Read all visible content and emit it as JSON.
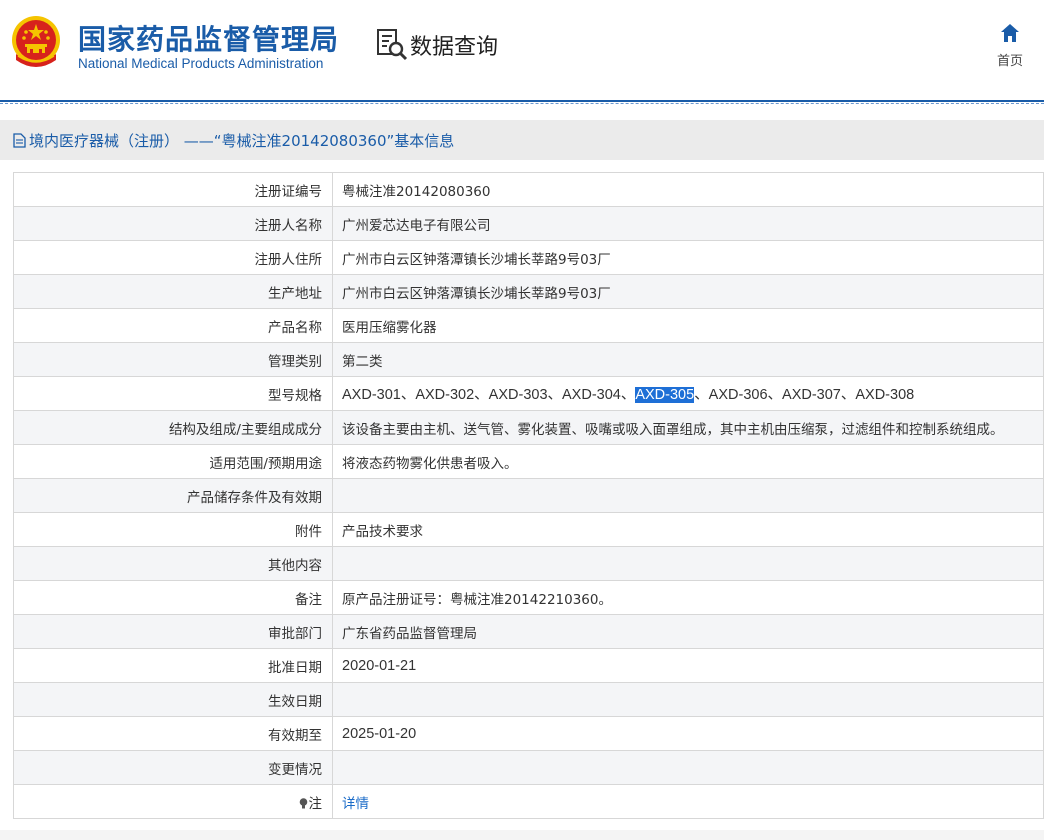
{
  "header": {
    "org_name_cn": "国家药品监督管理局",
    "org_name_en": "National Medical Products Administration",
    "query_label": "数据查询",
    "home_label": "首页"
  },
  "breadcrumb": {
    "text": "境内医疗器械（注册）  ——“粤械注准20142080360”基本信息"
  },
  "rows": [
    {
      "label": "注册证编号",
      "value": "粤械注准20142080360"
    },
    {
      "label": "注册人名称",
      "value": "广州爱芯达电子有限公司"
    },
    {
      "label": "注册人住所",
      "value": "广州市白云区钟落潭镇长沙埔长莘路9号03厂"
    },
    {
      "label": "生产地址",
      "value": "广州市白云区钟落潭镇长沙埔长莘路9号03厂"
    },
    {
      "label": "产品名称",
      "value": "医用压缩雾化器"
    },
    {
      "label": "管理类别",
      "value": "第二类"
    },
    {
      "label": "型号规格",
      "value_before": "AXD-301、AXD-302、AXD-303、AXD-304、",
      "value_selected": "AXD-305",
      "value_after": "、AXD-306、AXD-307、AXD-308"
    },
    {
      "label": "结构及组成/主要组成成分",
      "value": "该设备主要由主机、送气管、雾化装置、吸嘴或吸入面罩组成，其中主机由压缩泵，过滤组件和控制系统组成。"
    },
    {
      "label": "适用范围/预期用途",
      "value": "将液态药物雾化供患者吸入。"
    },
    {
      "label": "产品储存条件及有效期",
      "value": ""
    },
    {
      "label": "附件",
      "value": "产品技术要求"
    },
    {
      "label": "其他内容",
      "value": ""
    },
    {
      "label": "备注",
      "value": "原产品注册证号：粤械注准20142210360。"
    },
    {
      "label": "审批部门",
      "value": "广东省药品监督管理局"
    },
    {
      "label": "批准日期",
      "value": "2020-01-21"
    },
    {
      "label": "生效日期",
      "value": ""
    },
    {
      "label": "有效期至",
      "value": "2025-01-20"
    },
    {
      "label": "变更情况",
      "value": ""
    },
    {
      "label": "注",
      "value": "详情"
    }
  ],
  "colors": {
    "brand_blue": "#1a5ca8",
    "selection": "#1e6fd6",
    "link": "#1a6bc8",
    "emblem_red": "#d7221c",
    "emblem_gold": "#f5c400"
  },
  "icons": [
    "national-emblem-icon",
    "data-query-icon",
    "home-icon",
    "document-icon",
    "lightbulb-icon"
  ]
}
